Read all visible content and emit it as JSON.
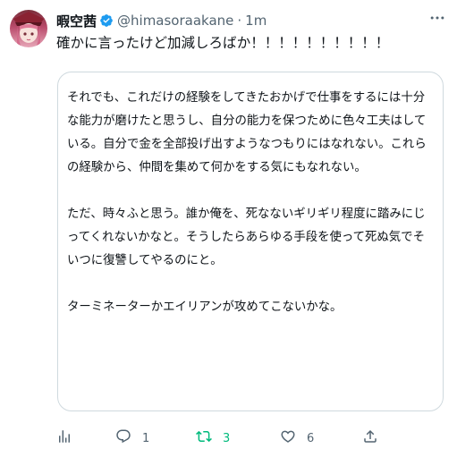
{
  "author": {
    "display_name": "暇空茜",
    "handle": "@himasoraakane",
    "separator": "·",
    "time": "1m",
    "verified": true
  },
  "tweet": {
    "text": "確かに言ったけど加減しろばか！！！！！！！！！！"
  },
  "quote": {
    "paragraphs": [
      "それでも、これだけの経験をしてきたおかげで仕事をするには十分な能力が磨けたと思うし、自分の能力を保つために色々工夫はしている。自分で金を全部投げ出すようなつもりにはなれない。これらの経験から、仲間を集めて何かをする気にもなれない。",
      "ただ、時々ふと思う。誰か俺を、死なないギリギリ程度に踏みにじってくれないかなと。そうしたらあらゆる手段を使って死ぬ気でそいつに復讐してやるのにと。",
      "ターミネーターかエイリアンが攻めてこないかな。"
    ]
  },
  "actions": {
    "replies": "1",
    "retweets": "3",
    "likes": "6"
  },
  "colors": {
    "text": "#0f1419",
    "secondary": "#536471",
    "verified": "#1d9bf0",
    "retweet": "#00ba7c",
    "border": "#cfd9de"
  },
  "icons": [
    "verified-badge-icon",
    "more-icon",
    "views-icon",
    "reply-icon",
    "retweet-icon",
    "like-icon",
    "share-icon"
  ]
}
